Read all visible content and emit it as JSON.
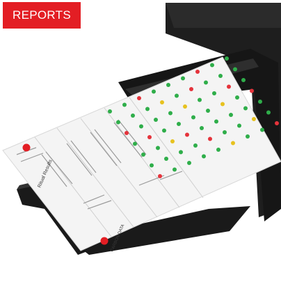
{
  "badge": {
    "label": "REPORTS"
  },
  "photo": {
    "subject": "printer-with-printed-report",
    "colors": {
      "badge": "#e31e24",
      "printer": "#1c1c1c",
      "paper": "#f3f3f3",
      "dot_green": "#2fae4a",
      "dot_red": "#e5333b",
      "dot_yellow": "#e7c21f"
    },
    "report": {
      "title": "Ritual Results",
      "brand": "CARBON DATA",
      "dot_rows": [
        [
          "green",
          "green",
          "red",
          "green",
          "green",
          "green",
          "red",
          "green",
          "green"
        ],
        [
          "green",
          "green",
          "green",
          "yellow",
          "green",
          "red",
          "green",
          "green",
          "green"
        ],
        [
          "red",
          "green",
          "green",
          "green",
          "yellow",
          "green",
          "green",
          "red",
          "green"
        ],
        [
          "green",
          "red",
          "green",
          "green",
          "green",
          "green",
          "yellow",
          "green",
          "red"
        ],
        [
          "green",
          "green",
          "yellow",
          "red",
          "green",
          "green",
          "green",
          "green",
          "green"
        ],
        [
          "green",
          "green",
          "green",
          "green",
          "red",
          "green",
          "green",
          "yellow",
          "green"
        ],
        [
          "red",
          "green",
          "green",
          "green",
          "green",
          "yellow",
          "green",
          "green",
          "red"
        ]
      ]
    }
  }
}
